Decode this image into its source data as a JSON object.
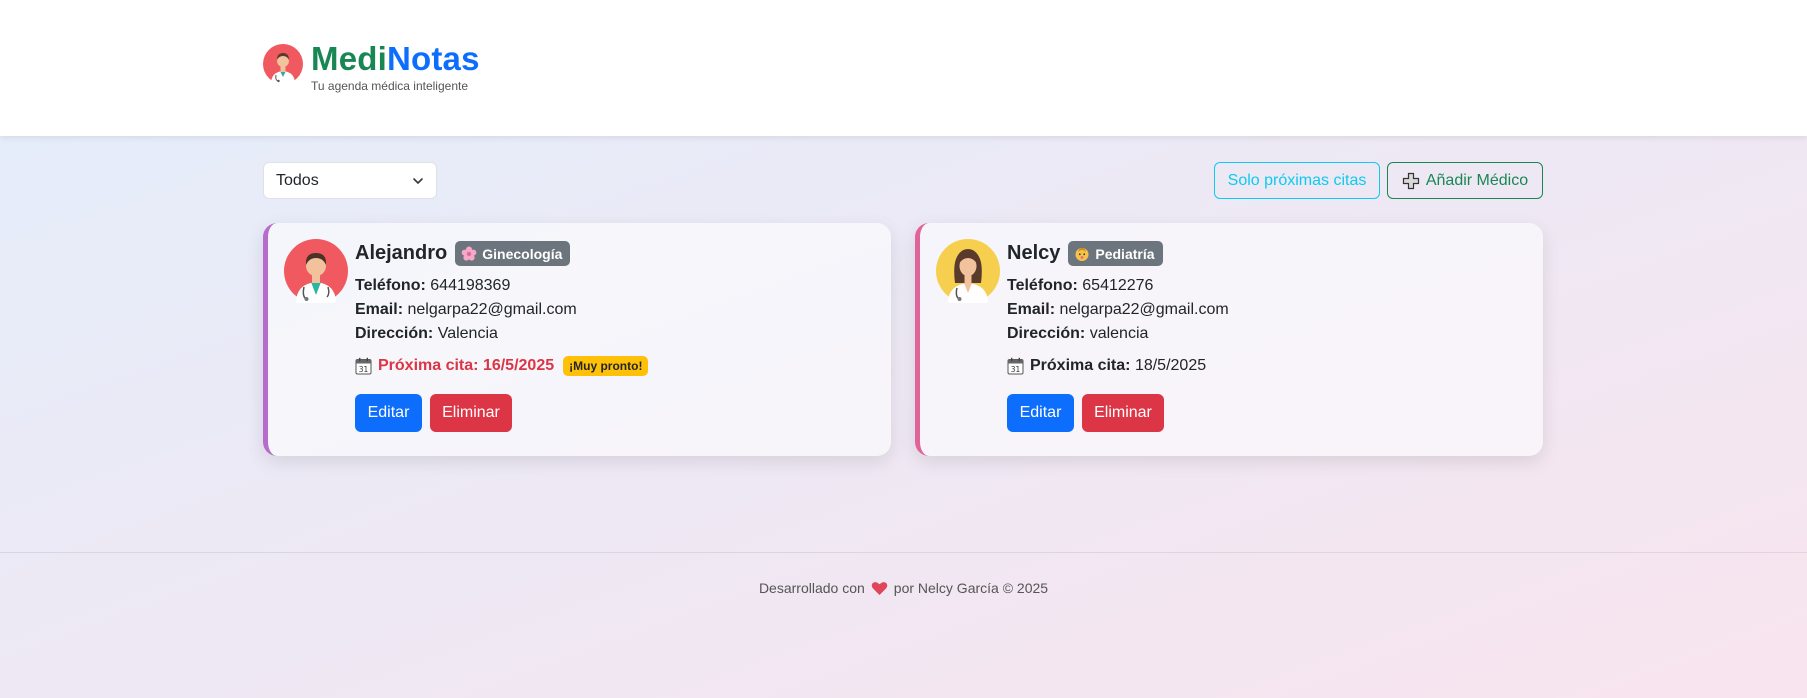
{
  "header": {
    "brand_part1": "Medi",
    "brand_part2": "Notas",
    "tagline": "Tu agenda médica inteligente",
    "colors": {
      "medi": "#198754",
      "notas": "#0d6efd"
    }
  },
  "toolbar": {
    "filter_value": "Todos",
    "only_upcoming_label": "Solo próximas citas",
    "add_doctor_label": "Añadir Médico"
  },
  "doctors": [
    {
      "name": "Alejandro",
      "specialty": "Ginecología",
      "specialty_icon": "flower-icon",
      "phone_label": "Teléfono:",
      "phone": "644198369",
      "email_label": "Email:",
      "email": "nelgarpa22@gmail.com",
      "address_label": "Dirección:",
      "address": "Valencia",
      "next_label": "Próxima cita:",
      "next_date": "16/5/2025",
      "soon_badge": "¡Muy pronto!",
      "edit_label": "Editar",
      "delete_label": "Eliminar",
      "accent": "#b66ccb"
    },
    {
      "name": "Nelcy",
      "specialty": "Pediatría",
      "specialty_icon": "baby-icon",
      "phone_label": "Teléfono:",
      "phone": "65412276",
      "email_label": "Email:",
      "email": "nelgarpa22@gmail.com",
      "address_label": "Dirección:",
      "address": "valencia",
      "next_label": "Próxima cita:",
      "next_date": "18/5/2025",
      "edit_label": "Editar",
      "delete_label": "Eliminar",
      "accent": "#e0649a"
    }
  ],
  "footer": {
    "text_before": "Desarrollado con",
    "text_after": "por Nelcy García © 2025"
  }
}
